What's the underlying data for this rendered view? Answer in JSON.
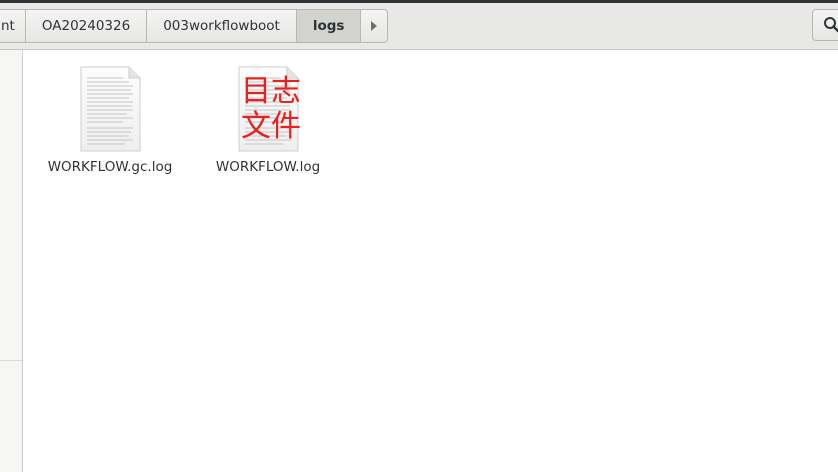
{
  "pathbar": {
    "crumbs": [
      "nt",
      "OA20240326",
      "003workflowboot",
      "logs"
    ],
    "active_index": 3,
    "forward_icon": "chevron-right-icon"
  },
  "toolbar": {
    "search_icon": "search-icon"
  },
  "files": [
    {
      "name": "WORKFLOW.gc.log",
      "icon": "text-file-icon",
      "overlay_text": ""
    },
    {
      "name": "WORKFLOW.log",
      "icon": "text-file-icon",
      "overlay_line1": "目志",
      "overlay_line2": "文件",
      "overlay_color": "#e8201e"
    }
  ]
}
